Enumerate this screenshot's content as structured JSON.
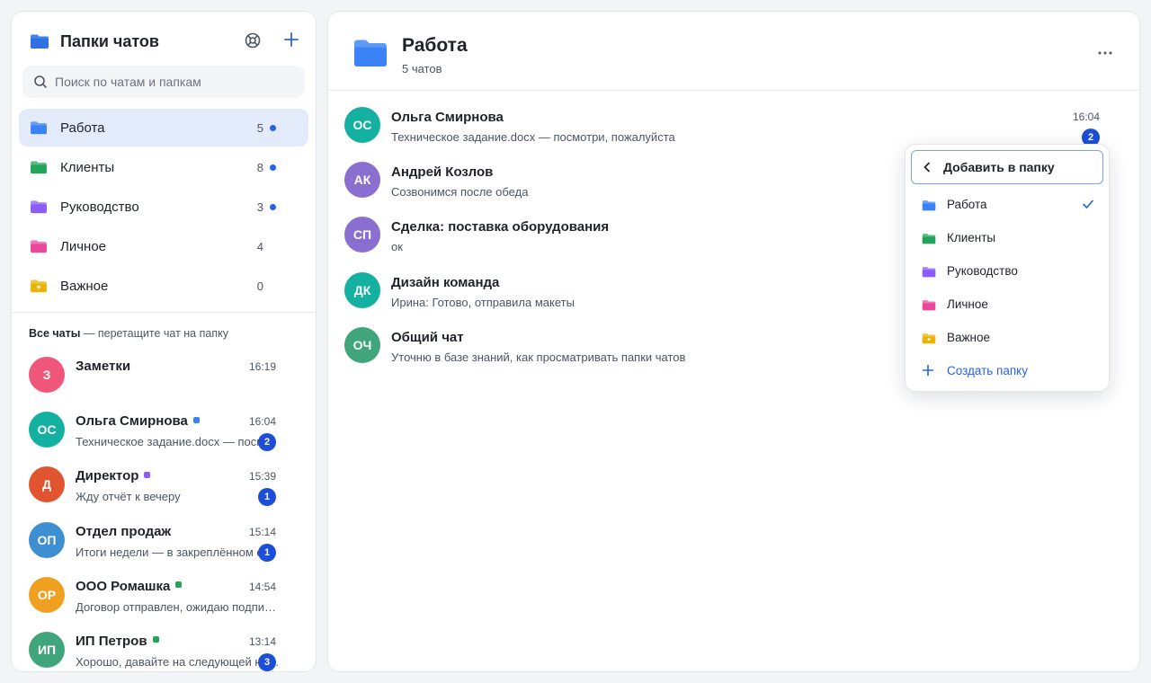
{
  "sidebar": {
    "title": "Папки чатов",
    "search_placeholder": "Поиск по чатам и папкам",
    "folders": [
      {
        "label": "Работа",
        "count": "5",
        "unread_dot": true,
        "color": "#3b82f6",
        "icon": "folder-icon",
        "active": true
      },
      {
        "label": "Клиенты",
        "count": "8",
        "unread_dot": true,
        "color": "#22a55a",
        "icon": "folder-icon",
        "active": false
      },
      {
        "label": "Руководство",
        "count": "3",
        "unread_dot": true,
        "color": "#8b5cf6",
        "icon": "folder-icon",
        "active": false
      },
      {
        "label": "Личное",
        "count": "4",
        "unread_dot": false,
        "color": "#ec4899",
        "icon": "folder-icon",
        "active": false
      },
      {
        "label": "Важное",
        "count": "0",
        "unread_dot": false,
        "color": "#eab308",
        "icon": "star-folder-icon",
        "active": false
      }
    ],
    "all_chats_label": "Все чаты",
    "all_chats_hint": " — перетащите чат на папку",
    "chats": [
      {
        "initials": "З",
        "name": "Заметки",
        "time": "16:19",
        "message": "",
        "badge": "",
        "avatar_color": "#f0567a",
        "tag_color": ""
      },
      {
        "initials": "ОС",
        "name": "Ольга Смирнова",
        "time": "16:04",
        "message": "Техническое задание.docx — посмотри, пожалуйста",
        "badge": "2",
        "avatar_color": "#14b0a0",
        "tag_color": "#3b82f6"
      },
      {
        "initials": "Д",
        "name": "Директор",
        "time": "15:39",
        "message": "Жду отчёт к вечеру",
        "badge": "1",
        "avatar_color": "#e0552f",
        "tag_color": "#8b5cf6"
      },
      {
        "initials": "ОП",
        "name": "Отдел продаж",
        "time": "15:14",
        "message": "Итоги недели — в закреплённом сообщении",
        "badge": "1",
        "avatar_color": "#3d8fd1",
        "tag_color": ""
      },
      {
        "initials": "ОР",
        "name": "ООО Ромашка",
        "time": "14:54",
        "message": "Договор отправлен, ожидаю подписанный экземпляр",
        "badge": "",
        "avatar_color": "#f0a020",
        "tag_color": "#22a55a"
      },
      {
        "initials": "ИП",
        "name": "ИП Петров",
        "time": "13:14",
        "message": "Хорошо, давайте на следующей неделе",
        "badge": "3",
        "avatar_color": "#40a57a",
        "tag_color": "#22a55a"
      }
    ]
  },
  "main": {
    "title": "Работа",
    "subtitle": "5 чатов",
    "chats": [
      {
        "initials": "ОС",
        "name": "Ольга Смирнова",
        "message": "Техническое задание.docx — посмотри, пожалуйста",
        "time": "16:04",
        "badge": "2",
        "avatar_color": "#14b0a0"
      },
      {
        "initials": "АК",
        "name": "Андрей Козлов",
        "message": "Созвонимся после обеда",
        "time": "",
        "badge": "",
        "avatar_color": "#8b6fd0"
      },
      {
        "initials": "СП",
        "name": "Сделка: поставка оборудования",
        "message": "ок",
        "time": "",
        "badge": "",
        "avatar_color": "#8b6fd0"
      },
      {
        "initials": "ДК",
        "name": "Дизайн команда",
        "message": "Ирина: Готово, отправила макеты",
        "time": "",
        "badge": "",
        "avatar_color": "#14b0a0"
      },
      {
        "initials": "ОЧ",
        "name": "Общий чат",
        "message": "Уточню в базе знаний, как просматривать папки чатов",
        "time": "",
        "badge": "",
        "avatar_color": "#40a57a"
      }
    ]
  },
  "popup": {
    "title": "Добавить в папку",
    "items": [
      {
        "label": "Работа",
        "color": "#3b82f6",
        "icon": "folder-icon",
        "checked": true
      },
      {
        "label": "Клиенты",
        "color": "#22a55a",
        "icon": "folder-icon",
        "checked": false
      },
      {
        "label": "Руководство",
        "color": "#8b5cf6",
        "icon": "folder-icon",
        "checked": false
      },
      {
        "label": "Личное",
        "color": "#ec4899",
        "icon": "folder-icon",
        "checked": false
      },
      {
        "label": "Важное",
        "color": "#eab308",
        "icon": "star-folder-icon",
        "checked": false
      }
    ],
    "create_label": "Создать папку"
  }
}
